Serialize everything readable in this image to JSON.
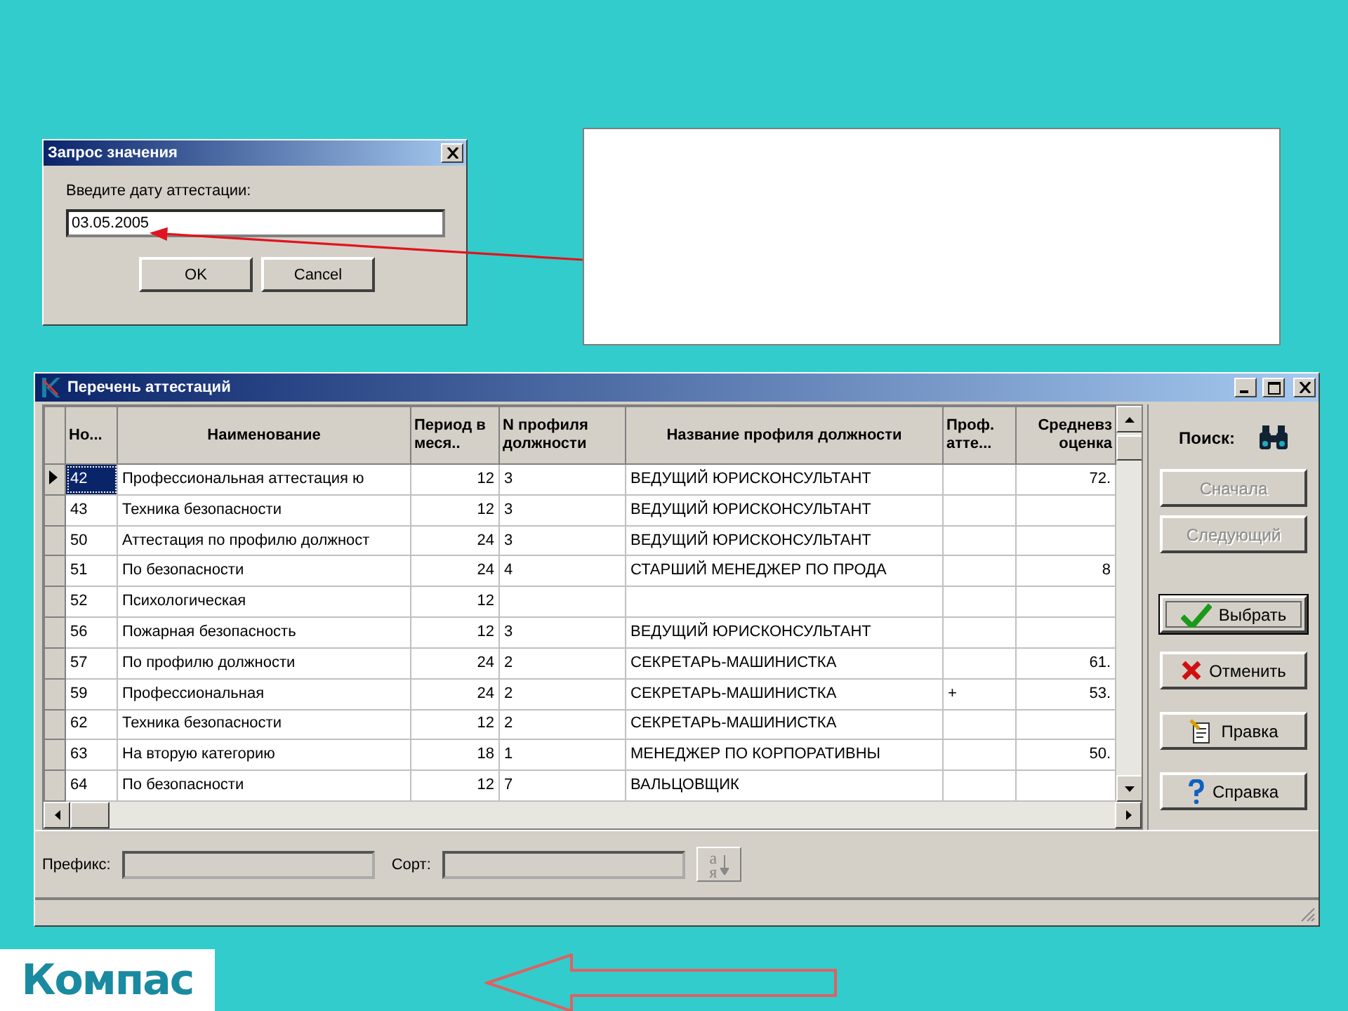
{
  "dialog": {
    "title": "Запрос значения",
    "label": "Введите дату аттестации:",
    "value": "03.05.2005",
    "buttons": [
      "OK",
      "Cancel"
    ]
  },
  "main_window": {
    "title": "Перечень аттестаций",
    "columns": [
      "Но...",
      "Наименование",
      "Период в меся..",
      "N профиля должности",
      "Название профиля должности",
      "Проф. атте...",
      "Средневз оценка"
    ],
    "rows": [
      {
        "selected": true,
        "cells": [
          "42",
          "Профессиональная аттестация ю",
          "12",
          "3",
          "ВЕДУЩИЙ ЮРИСКОНСУЛЬТАНТ",
          null,
          "72."
        ]
      },
      {
        "selected": false,
        "cells": [
          "43",
          "Техника безопасности",
          "12",
          "3",
          "ВЕДУЩИЙ ЮРИСКОНСУЛЬТАНТ",
          null,
          null
        ]
      },
      {
        "selected": false,
        "cells": [
          "50",
          "Аттестация по профилю должност",
          "24",
          "3",
          "ВЕДУЩИЙ ЮРИСКОНСУЛЬТАНТ",
          null,
          null
        ]
      },
      {
        "selected": false,
        "cells": [
          "51",
          "По безопасности",
          "24",
          "4",
          "СТАРШИЙ МЕНЕДЖЕР ПО ПРОДА",
          null,
          "8"
        ]
      },
      {
        "selected": false,
        "cells": [
          "52",
          "Психологическая",
          "12",
          null,
          null,
          null,
          null
        ]
      },
      {
        "selected": false,
        "cells": [
          "56",
          "Пожарная безопасность",
          "12",
          "3",
          "ВЕДУЩИЙ ЮРИСКОНСУЛЬТАНТ",
          null,
          null
        ]
      },
      {
        "selected": false,
        "cells": [
          "57",
          "По профилю должности",
          "24",
          "2",
          "СЕКРЕТАРЬ-МАШИНИСТКА",
          null,
          "61."
        ]
      },
      {
        "selected": false,
        "cells": [
          "59",
          "Профессиональная",
          "24",
          "2",
          "СЕКРЕТАРЬ-МАШИНИСТКА",
          "+",
          "53."
        ]
      },
      {
        "selected": false,
        "cells": [
          "62",
          "Техника безопасности",
          "12",
          "2",
          "СЕКРЕТАРЬ-МАШИНИСТКА",
          null,
          null
        ]
      },
      {
        "selected": false,
        "cells": [
          "63",
          "На вторую категорию",
          "18",
          "1",
          "МЕНЕДЖЕР ПО КОРПОРАТИВНЫ",
          null,
          "50."
        ]
      },
      {
        "selected": false,
        "cells": [
          "64",
          "По безопасности",
          "12",
          "7",
          "ВАЛЬЦОВЩИК",
          null,
          null
        ]
      }
    ],
    "search_label": "Поиск:",
    "buttons": [
      {
        "label": "Сначала",
        "kind": "plain",
        "disabled": true,
        "default": false
      },
      {
        "label": "Следующий",
        "kind": "plain",
        "disabled": true,
        "default": false
      },
      {
        "label": "Выбрать",
        "kind": "accept",
        "disabled": false,
        "default": true
      },
      {
        "label": "Отменить",
        "kind": "cancel",
        "disabled": false,
        "default": false
      },
      {
        "label": "Правка",
        "kind": "edit",
        "disabled": false,
        "default": false
      },
      {
        "label": "Справка",
        "kind": "help",
        "disabled": false,
        "default": false
      }
    ],
    "prefix_label": "Префикс:",
    "sort_label": "Сорт:",
    "sort_button": {
      "letters": [
        "а",
        "я"
      ]
    }
  },
  "logo": {
    "text": "Компас"
  }
}
